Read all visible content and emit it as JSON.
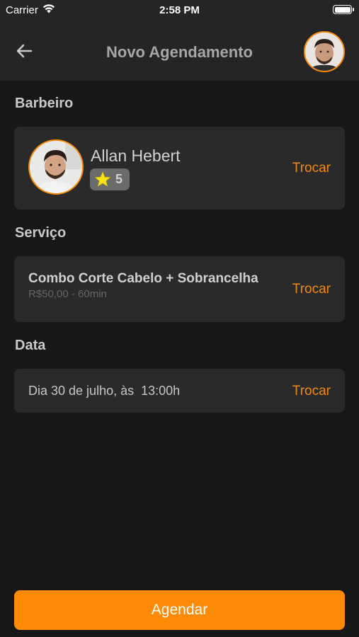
{
  "status_bar": {
    "carrier": "Carrier",
    "time": "2:58 PM"
  },
  "header": {
    "title": "Novo Agendamento"
  },
  "barber": {
    "section_title": "Barbeiro",
    "name": "Allan Hebert",
    "rating": "5",
    "change_label": "Trocar"
  },
  "service": {
    "section_title": "Serviço",
    "name": "Combo Corte Cabelo + Sobrancelha",
    "details": "R$50,00 - 60min",
    "change_label": "Trocar"
  },
  "date": {
    "section_title": "Data",
    "text": "Dia 30 de julho, às  13:00h",
    "change_label": "Trocar"
  },
  "actions": {
    "schedule_label": "Agendar"
  },
  "colors": {
    "accent": "#ff8a05",
    "background": "#171717",
    "card": "#2a2a2a",
    "header": "#252525"
  }
}
